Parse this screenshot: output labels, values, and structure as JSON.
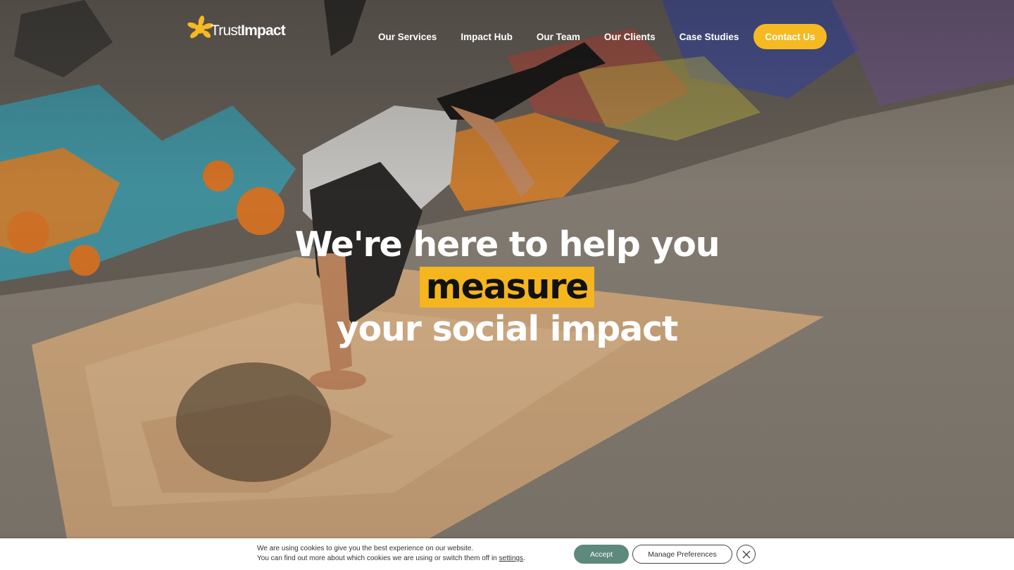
{
  "brand": {
    "name_part1": "Trust",
    "name_part2": "Impact",
    "accent_color": "#f5b921"
  },
  "nav": {
    "items": [
      {
        "label": "Our Services"
      },
      {
        "label": "Impact Hub"
      },
      {
        "label": "Our Team"
      },
      {
        "label": "Our Clients"
      },
      {
        "label": "Case Studies"
      }
    ],
    "contact_label": "Contact Us"
  },
  "hero": {
    "line1": "We're here to help you",
    "highlight": "measure",
    "line3": "your social impact",
    "highlight_color": "#f4b51f"
  },
  "cookie": {
    "line1": "We are using cookies to give you the best experience on our website.",
    "line2_prefix": "You can find out more about which cookies we are using or switch them off in ",
    "line2_link": "settings",
    "line2_suffix": ".",
    "accept_label": "Accept",
    "prefs_label": "Manage Preferences",
    "close_icon": "close-icon",
    "accept_color": "#5d8a7c"
  }
}
